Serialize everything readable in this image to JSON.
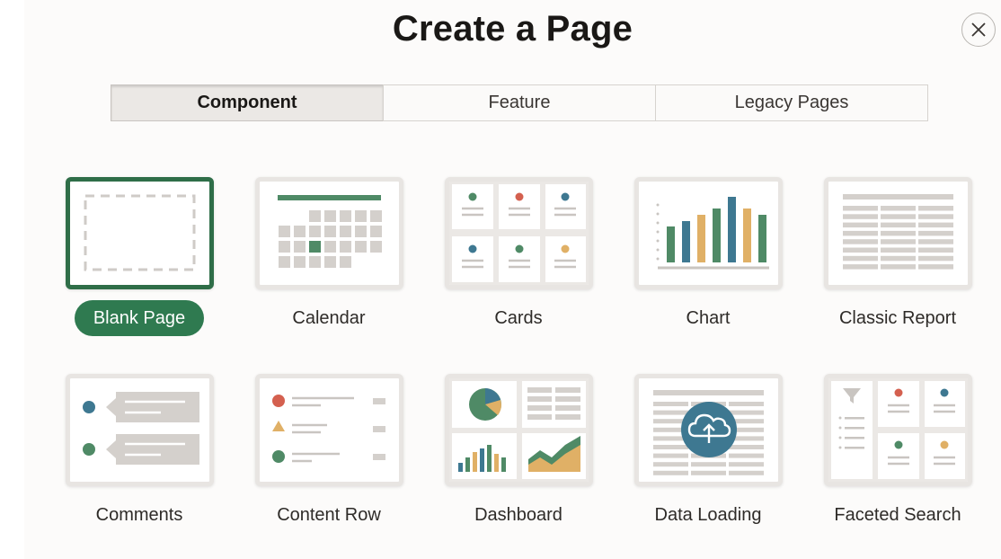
{
  "dialog": {
    "title": "Create a Page",
    "close_icon": "close-icon"
  },
  "tabs": [
    {
      "label": "Component",
      "active": true
    },
    {
      "label": "Feature",
      "active": false
    },
    {
      "label": "Legacy Pages",
      "active": false
    }
  ],
  "colors": {
    "accent_green": "#2f7a50",
    "chart_green": "#4f8a66",
    "chart_blue": "#3e7891",
    "chart_gold": "#e0b066",
    "dot_red": "#d4604f",
    "gray_block": "#d4d0cc",
    "gray_line": "#c9c5c1"
  },
  "templates": [
    {
      "label": "Blank Page",
      "selected": true,
      "icon": "blank-page-icon"
    },
    {
      "label": "Calendar",
      "selected": false,
      "icon": "calendar-icon"
    },
    {
      "label": "Cards",
      "selected": false,
      "icon": "cards-icon"
    },
    {
      "label": "Chart",
      "selected": false,
      "icon": "chart-icon"
    },
    {
      "label": "Classic Report",
      "selected": false,
      "icon": "classic-report-icon"
    },
    {
      "label": "Comments",
      "selected": false,
      "icon": "comments-icon"
    },
    {
      "label": "Content Row",
      "selected": false,
      "icon": "content-row-icon"
    },
    {
      "label": "Dashboard",
      "selected": false,
      "icon": "dashboard-icon"
    },
    {
      "label": "Data Loading",
      "selected": false,
      "icon": "cloud-upload-icon"
    },
    {
      "label": "Faceted Search",
      "selected": false,
      "icon": "faceted-search-icon"
    }
  ]
}
